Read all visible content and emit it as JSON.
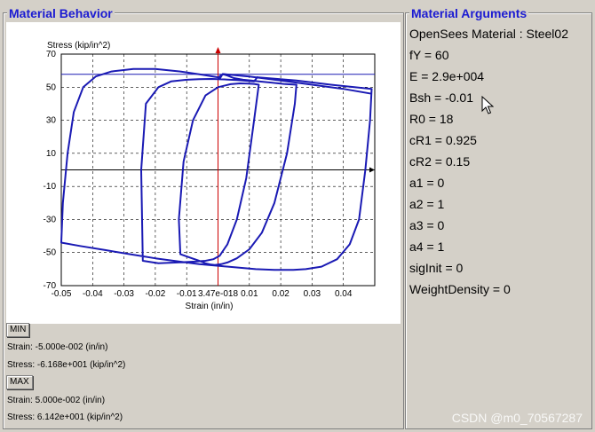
{
  "left_panel": {
    "title": "Material Behavior",
    "min_button": "MIN",
    "min_strain": "Strain: -5.000e-002 (in/in)",
    "min_stress": "Stress: -6.168e+001 (kip/in^2)",
    "max_button": "MAX",
    "max_strain": "Strain: 5.000e-002 (in/in)",
    "max_stress": "Stress: 6.142e+001 (kip/in^2)"
  },
  "right_panel": {
    "title": "Material Arguments",
    "args": [
      "OpenSees Material : Steel02",
      "fY = 60",
      "E = 2.9e+004",
      "Bsh = -0.01",
      "R0 = 18",
      "cR1 = 0.925",
      "cR2 = 0.15",
      "a1 = 0",
      "a2 = 1",
      "a3 = 0",
      "a4 = 1",
      "sigInit = 0",
      "WeightDensity = 0"
    ]
  },
  "watermark": "CSDN @m0_70567287",
  "chart_data": {
    "type": "line",
    "title": "",
    "xlabel": "Strain (in/in)",
    "ylabel": "Stress (kip/in^2)",
    "xlim": [
      -0.05,
      0.05
    ],
    "ylim": [
      -70,
      70
    ],
    "x_tick_labels": [
      "-0.05",
      "-0.04",
      "-0.03",
      "-0.02",
      "-0.01",
      "3.47e-018",
      "0.01",
      "0.02",
      "0.03",
      "0.04"
    ],
    "y_tick_labels": [
      "70",
      "50",
      "30",
      "10",
      "-10",
      "-30",
      "-50",
      "-70"
    ],
    "x_ticks": [
      -0.05,
      -0.04,
      -0.03,
      -0.02,
      -0.01,
      0,
      0.01,
      0.02,
      0.03,
      0.04
    ],
    "y_ticks": [
      70,
      50,
      30,
      10,
      -10,
      -30,
      -50,
      -70
    ],
    "grid": true,
    "reference_line_y": 57.8,
    "colors": {
      "curve": "#1a1ab4",
      "cursor_line": "#cc0000",
      "reference": "#1a1ab4",
      "axes": "#000000"
    },
    "series": [
      {
        "x": [
          0.0,
          0.0008,
          0.0016,
          0.003,
          0.005,
          0.008,
          0.0105,
          0.013,
          0.017,
          0.021,
          0.025,
          0.0245,
          0.022,
          0.018,
          0.014,
          0.01,
          0.006,
          0.003,
          0.001,
          -0.001,
          -0.0025,
          -0.004,
          -0.006,
          -0.009,
          -0.012,
          -0.0125,
          -0.011,
          -0.008,
          -0.004,
          0.0,
          0.004,
          0.007,
          0.0095,
          0.0115,
          0.013,
          0.0115,
          0.009,
          0.006,
          0.003,
          0.0005,
          -0.0015,
          -0.004,
          -0.008,
          -0.013,
          -0.019,
          -0.024,
          -0.0245,
          -0.023,
          -0.019,
          -0.015,
          -0.01,
          -0.006,
          -0.002,
          0.002,
          0.006,
          0.0115,
          0.0125,
          0.025,
          0.036,
          0.049,
          0.0485,
          0.047,
          0.045,
          0.042,
          0.038,
          0.033,
          0.028,
          0.024,
          0.018,
          0.012,
          0.006,
          0.0,
          -0.006,
          -0.012,
          -0.02,
          -0.028,
          -0.036,
          -0.044,
          -0.05,
          -0.0495,
          -0.048,
          -0.046,
          -0.043,
          -0.039,
          -0.034,
          -0.027,
          -0.02,
          -0.012,
          -0.005,
          0.0,
          0.0005,
          0.0015,
          0.01,
          0.02,
          0.03,
          0.04,
          0.049
        ],
        "y": [
          55.5,
          57.0,
          57.8,
          57.0,
          55.5,
          54.5,
          54.0,
          53.5,
          52.8,
          52.0,
          51.5,
          40.0,
          10.0,
          -20.0,
          -38.0,
          -48.0,
          -53.5,
          -56.0,
          -57.0,
          -57.5,
          -57.2,
          -56.5,
          -55.0,
          -53.0,
          -51.0,
          -30.0,
          5.0,
          30.0,
          45.0,
          50.0,
          51.8,
          52.3,
          52.2,
          52.0,
          51.5,
          30.0,
          -5.0,
          -30.0,
          -45.0,
          -52.0,
          -54.0,
          -55.0,
          -55.5,
          -56.0,
          -56.5,
          -55.0,
          0.0,
          40.0,
          50.0,
          53.5,
          54.5,
          54.8,
          55.0,
          54.7,
          54.3,
          53.5,
          56.0,
          54.0,
          51.5,
          49.0,
          30.0,
          0.0,
          -30.0,
          -45.0,
          -54.0,
          -58.5,
          -60.0,
          -60.5,
          -60.5,
          -60.0,
          -59.0,
          -58.0,
          -57.0,
          -55.5,
          -53.5,
          -51.0,
          -48.5,
          -46.0,
          -44.0,
          -20.0,
          10.0,
          35.0,
          50.0,
          56.5,
          59.5,
          61.0,
          61.0,
          59.5,
          57.5,
          56.0,
          55.0,
          58.0,
          56.5,
          54.0,
          51.5,
          49.0,
          46.0
        ]
      }
    ],
    "annotations": [
      "3.47e-018"
    ]
  }
}
